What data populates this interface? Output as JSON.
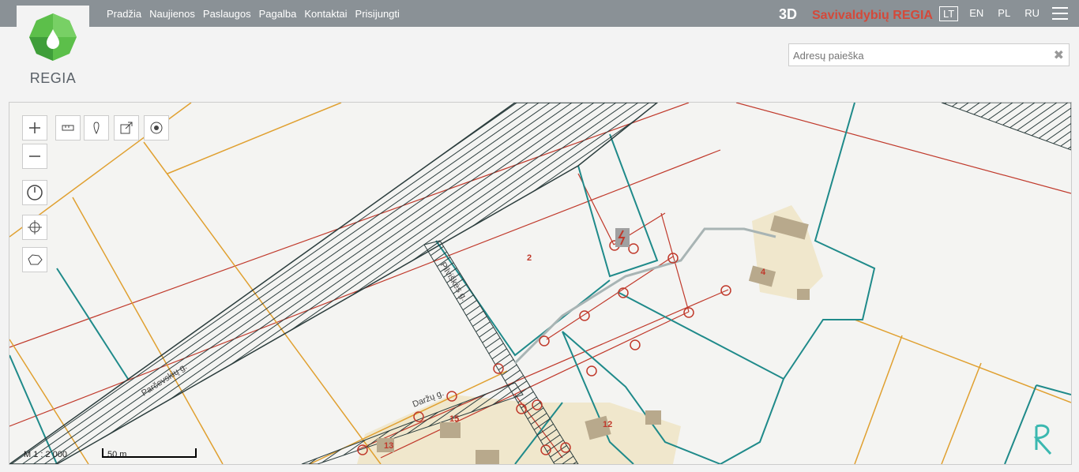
{
  "nav": {
    "items": [
      "Pradžia",
      "Naujienos",
      "Paslaugos",
      "Pagalba",
      "Kontaktai",
      "Prisijungti"
    ]
  },
  "logo": {
    "text": "REGIA"
  },
  "header": {
    "mode_3d": "3D",
    "brand": "Savivaldybių REGIA"
  },
  "languages": {
    "items": [
      "LT",
      "EN",
      "PL",
      "RU"
    ],
    "active": "LT"
  },
  "search": {
    "placeholder": "Adresų paieška",
    "clear": "✖"
  },
  "map": {
    "streets": [
      "Parčevskių g.",
      "Pilviškės g.",
      "Daržų g."
    ],
    "parcel_numbers": [
      "2",
      "4",
      "12",
      "13",
      "15"
    ],
    "scale_ratio": "M 1 : 2 000",
    "scale_distance": "50 m"
  },
  "colors": {
    "topbar": "#8a9196",
    "brand": "#d4493a",
    "parcel": "#1f8a8a",
    "boundary": "#e0a030",
    "utility": "#c0392b"
  },
  "icons": [
    "zoom-in-icon",
    "zoom-out-icon",
    "measure-icon",
    "pin-icon",
    "share-icon",
    "target-icon",
    "clock-icon",
    "crosshair-icon",
    "map-outline-icon",
    "hamburger-icon",
    "regia-logo-icon"
  ]
}
